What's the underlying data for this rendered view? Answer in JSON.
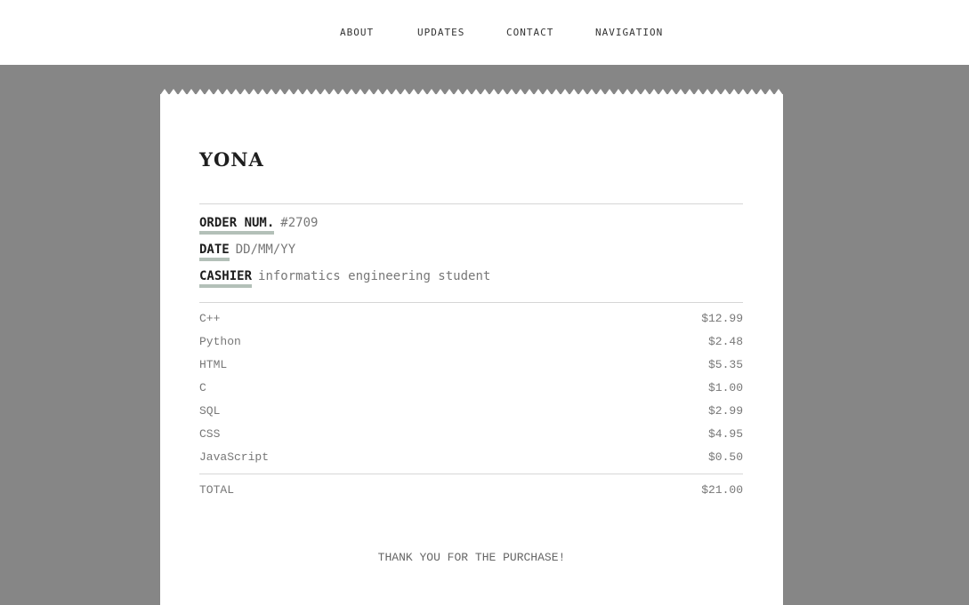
{
  "nav": {
    "items": [
      {
        "label": "ABOUT"
      },
      {
        "label": "UPDATES"
      },
      {
        "label": "CONTACT"
      },
      {
        "label": "NAVIGATION"
      }
    ]
  },
  "receipt": {
    "shop_name": "YONA",
    "meta": {
      "order_label": "ORDER NUM.",
      "order_value": "#2709",
      "date_label": "DATE",
      "date_value": "DD/MM/YY",
      "cashier_label": "CASHIER",
      "cashier_value": "informatics engineering student"
    },
    "items": [
      {
        "name": "C++",
        "price": "$12.99"
      },
      {
        "name": "Python",
        "price": "$2.48"
      },
      {
        "name": "HTML",
        "price": "$5.35"
      },
      {
        "name": "C",
        "price": "$1.00"
      },
      {
        "name": "SQL",
        "price": "$2.99"
      },
      {
        "name": "CSS",
        "price": "$4.95"
      },
      {
        "name": "JavaScript",
        "price": "$0.50"
      }
    ],
    "total_label": "TOTAL",
    "total_value": "$21.00",
    "thank_you": "THANK YOU FOR THE PURCHASE!"
  }
}
